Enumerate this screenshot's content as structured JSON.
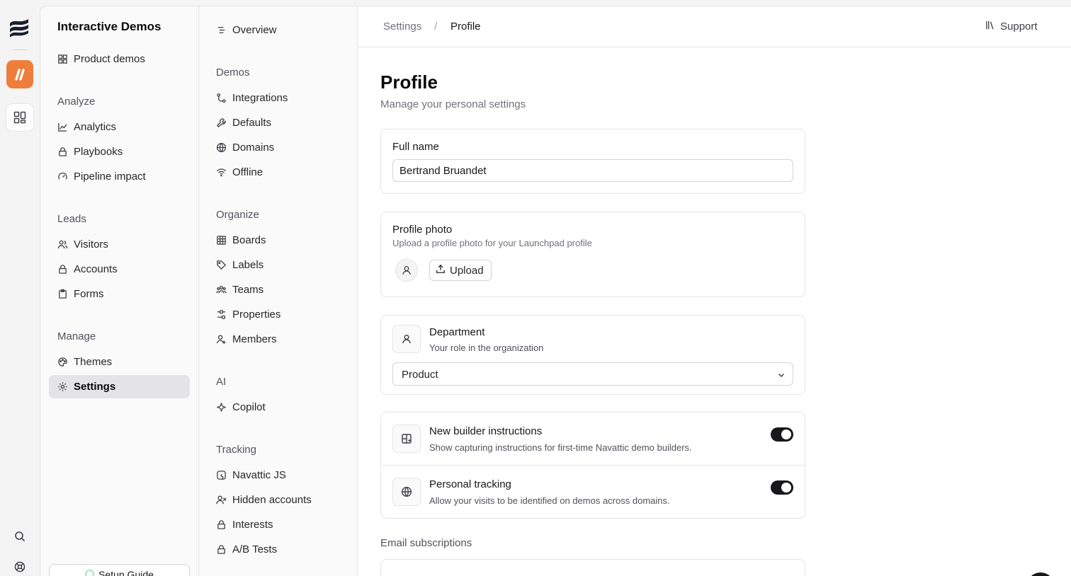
{
  "rail": {
    "icons": [
      "navattic-logo-icon",
      "app-launchpad-icon",
      "apps-grid-icon",
      "search-icon",
      "help-icon"
    ]
  },
  "workspace": {
    "title": "Interactive Demos"
  },
  "nav1": {
    "top_item": "Product demos",
    "sections": [
      {
        "title": "Analyze",
        "items": [
          "Analytics",
          "Playbooks",
          "Pipeline impact"
        ]
      },
      {
        "title": "Leads",
        "items": [
          "Visitors",
          "Accounts",
          "Forms"
        ]
      },
      {
        "title": "Manage",
        "items": [
          "Themes",
          "Settings"
        ]
      }
    ],
    "setup_guide": "Setup Guide"
  },
  "nav2": {
    "overview": "Overview",
    "sections": [
      {
        "title": "Demos",
        "items": [
          "Integrations",
          "Defaults",
          "Domains",
          "Offline"
        ]
      },
      {
        "title": "Organize",
        "items": [
          "Boards",
          "Labels",
          "Teams",
          "Properties",
          "Members"
        ]
      },
      {
        "title": "AI",
        "items": [
          "Copilot"
        ]
      },
      {
        "title": "Tracking",
        "items": [
          "Navattic JS",
          "Hidden accounts",
          "Interests",
          "A/B Tests"
        ]
      }
    ]
  },
  "topbar": {
    "crumbs": [
      "Settings",
      "Profile"
    ],
    "separator": "/",
    "support": "Support"
  },
  "page": {
    "title": "Profile",
    "subtitle": "Manage your personal settings",
    "full_name": {
      "label": "Full name",
      "value": "Bertrand Bruandet"
    },
    "photo": {
      "label": "Profile photo",
      "hint": "Upload a profile photo for your Launchpad profile",
      "button": "Upload"
    },
    "department": {
      "label": "Department",
      "hint": "Your role in the organization",
      "selected": "Product"
    },
    "toggles": [
      {
        "title": "New builder instructions",
        "desc": "Show capturing instructions for first-time Navattic demo builders.",
        "on": true
      },
      {
        "title": "Personal tracking",
        "desc": "Allow your visits to be identified on demos across domains.",
        "on": true
      }
    ],
    "email_section": "Email subscriptions"
  }
}
